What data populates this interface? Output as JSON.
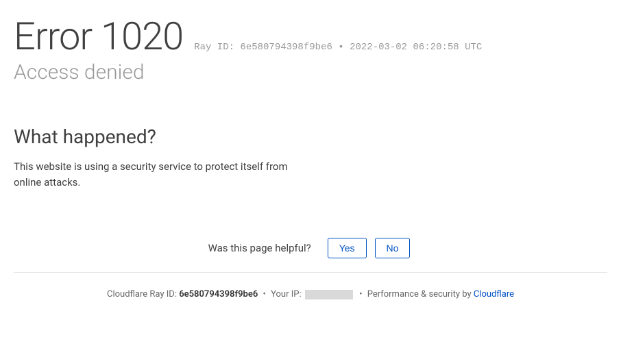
{
  "header": {
    "title": "Error 1020",
    "ray_label": "Ray ID:",
    "ray_id": "6e580794398f9be6",
    "timestamp": "2022-03-02 06:20:58 UTC",
    "subtitle": "Access denied"
  },
  "section": {
    "heading": "What happened?",
    "body": "This website is using a security service to protect itself from online attacks."
  },
  "feedback": {
    "label": "Was this page helpful?",
    "yes": "Yes",
    "no": "No"
  },
  "footer": {
    "ray_label": "Cloudflare Ray ID:",
    "ray_id": "6e580794398f9be6",
    "ip_label": "Your IP:",
    "security_label": "Performance & security by",
    "provider": "Cloudflare"
  }
}
